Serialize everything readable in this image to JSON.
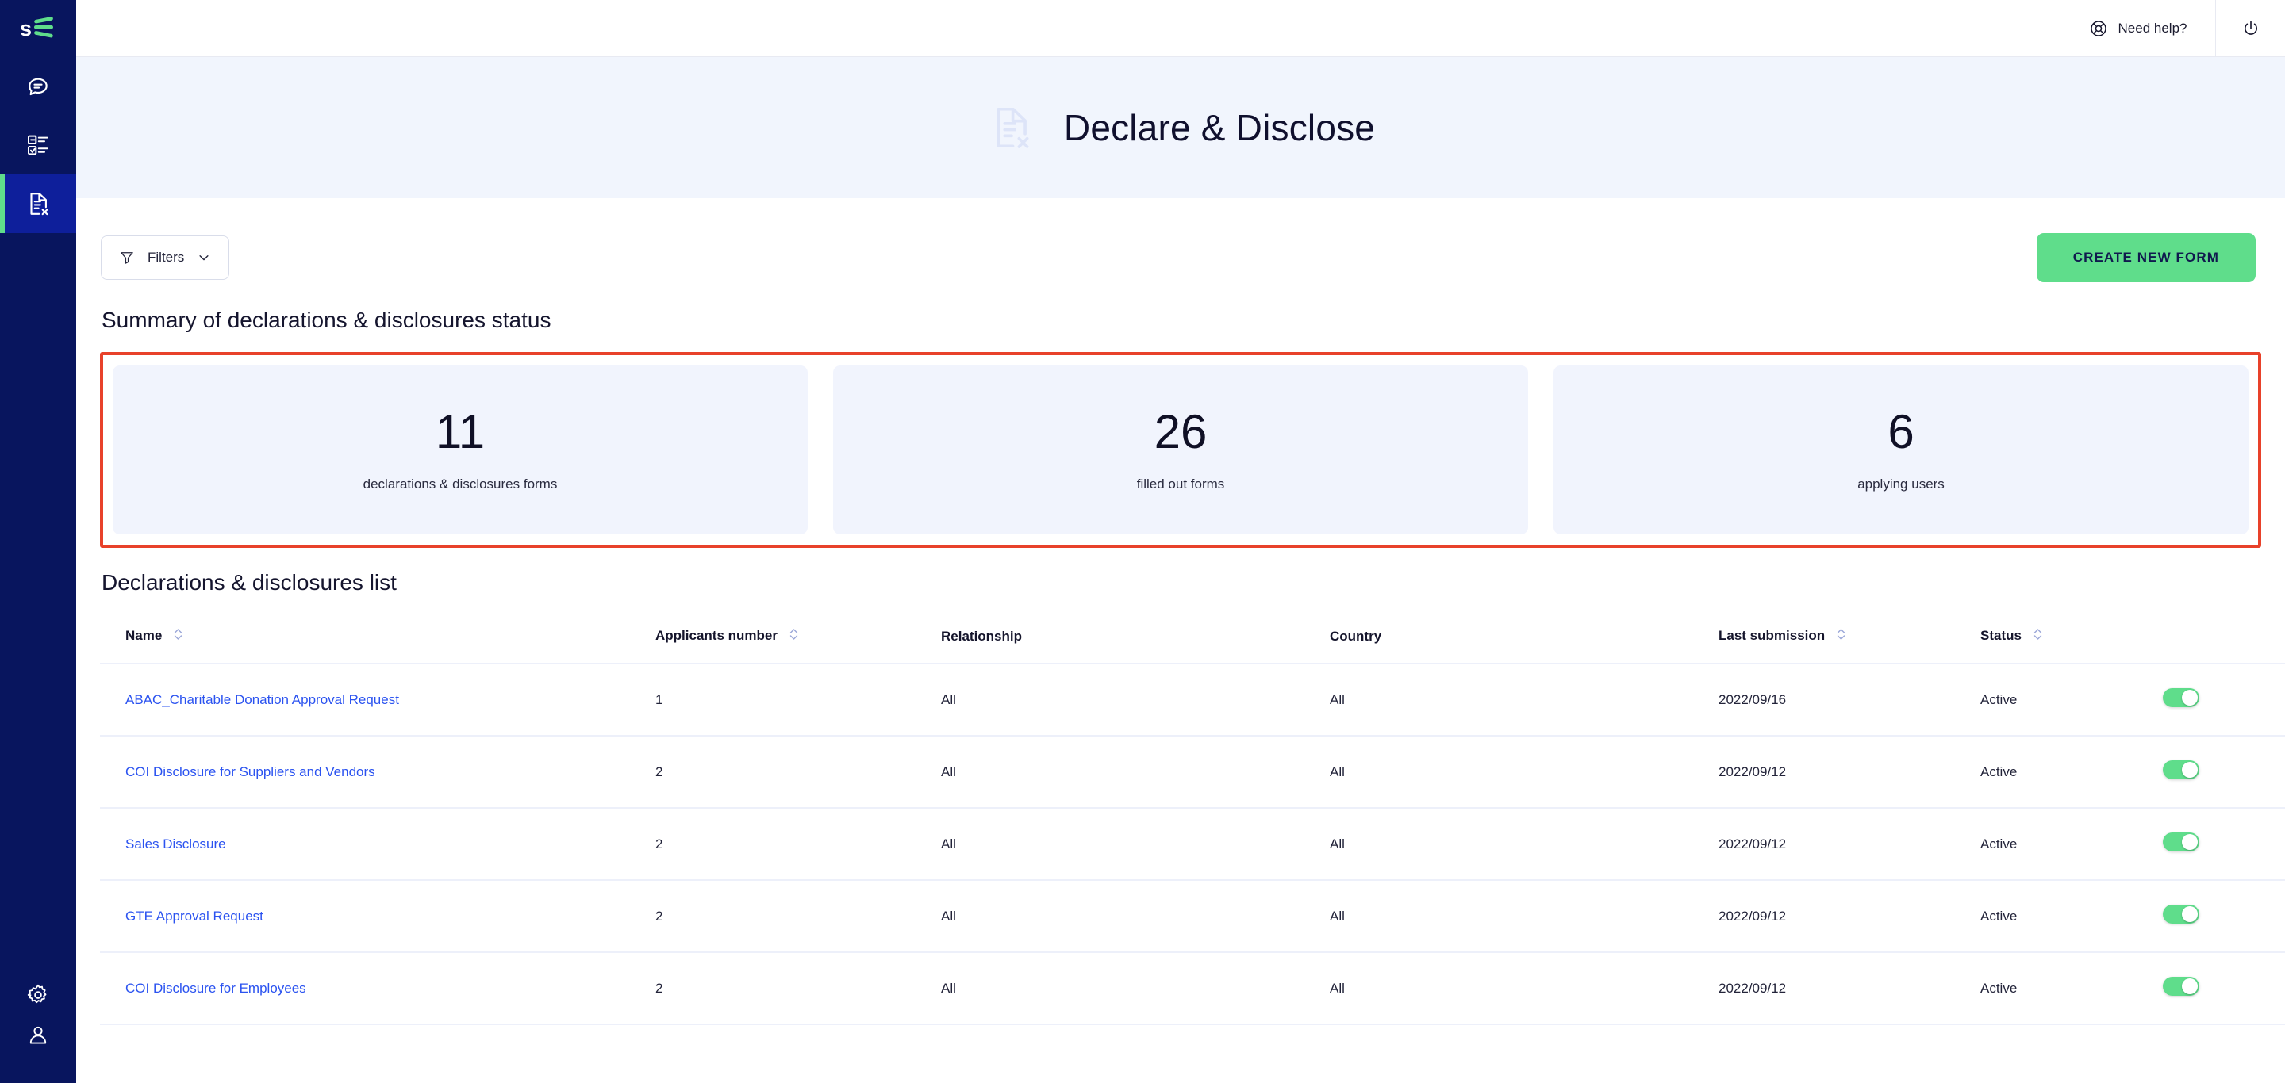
{
  "sidebar": {
    "logo": "SE",
    "items": [
      {
        "name": "chat-icon",
        "label": "Chat",
        "active": false
      },
      {
        "name": "tasks-icon",
        "label": "Tasks",
        "active": false
      },
      {
        "name": "declare-disclose-icon",
        "label": "Declare & Disclose",
        "active": true
      }
    ],
    "bottom_items": [
      {
        "name": "gear-icon",
        "label": "Settings"
      },
      {
        "name": "user-icon",
        "label": "Profile"
      }
    ]
  },
  "topbar": {
    "help_label": "Need help?",
    "help_icon": "lifebuoy-icon",
    "power_icon": "power-icon"
  },
  "banner": {
    "title": "Declare & Disclose",
    "icon": "document-x-icon",
    "background": "#F1F5FD"
  },
  "toolbar": {
    "filters_label": "Filters",
    "filters_icon": "funnel-icon",
    "filters_chevron": "chevron-down-icon",
    "create_label": "CREATE NEW FORM",
    "create_color": "#5FDD8B"
  },
  "summary": {
    "heading": "Summary of declarations & disclosures status",
    "highlight_color": "#E8412A",
    "cards": [
      {
        "value": "11",
        "label": "declarations & disclosures forms"
      },
      {
        "value": "26",
        "label": "filled out forms"
      },
      {
        "value": "6",
        "label": "applying users"
      }
    ]
  },
  "list": {
    "heading": "Declarations & disclosures list",
    "columns": [
      {
        "label": "Name",
        "sortable": true
      },
      {
        "label": "Applicants number",
        "sortable": true
      },
      {
        "label": "Relationship",
        "sortable": false
      },
      {
        "label": "Country",
        "sortable": false
      },
      {
        "label": "Last submission",
        "sortable": true
      },
      {
        "label": "Status",
        "sortable": true
      },
      {
        "label": "",
        "sortable": false
      }
    ],
    "rows": [
      {
        "name": "ABAC_Charitable Donation Approval Request",
        "applicants": "1",
        "relationship": "All",
        "country": "All",
        "last_submission": "2022/09/16",
        "status": "Active",
        "toggle_on": true
      },
      {
        "name": "COI Disclosure for Suppliers and Vendors",
        "applicants": "2",
        "relationship": "All",
        "country": "All",
        "last_submission": "2022/09/12",
        "status": "Active",
        "toggle_on": true
      },
      {
        "name": "Sales Disclosure",
        "applicants": "2",
        "relationship": "All",
        "country": "All",
        "last_submission": "2022/09/12",
        "status": "Active",
        "toggle_on": true
      },
      {
        "name": "GTE Approval Request",
        "applicants": "2",
        "relationship": "All",
        "country": "All",
        "last_submission": "2022/09/12",
        "status": "Active",
        "toggle_on": true
      },
      {
        "name": "COI Disclosure for Employees",
        "applicants": "2",
        "relationship": "All",
        "country": "All",
        "last_submission": "2022/09/12",
        "status": "Active",
        "toggle_on": true
      }
    ]
  }
}
